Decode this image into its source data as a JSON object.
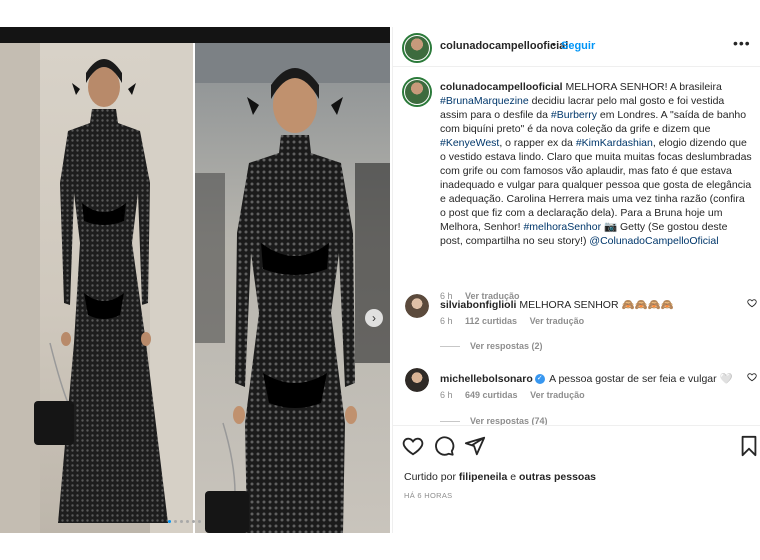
{
  "post": {
    "username": "colunadocampellooficial",
    "follow_label": "Seguir",
    "separator": "•",
    "more_label": "•••"
  },
  "caption": {
    "username": "colunadocampellooficial",
    "text_1": " MELHORA SENHOR! A brasileira ",
    "tag_1": "#BrunaMarquezine",
    "text_2": " decidiu lacrar pelo mal gosto e foi vestida assim para o desfile da ",
    "tag_2": "#Burberry",
    "text_3": " em Londres. A \"saída de banho com biquíni preto\" é da nova coleção da grife e dizem que ",
    "tag_3": "#KenyeWest",
    "text_4": ", o rapper ex da ",
    "tag_4": "#KimKardashian",
    "text_5": ", elogio dizendo que o vestido estava lindo. Claro que muita muitas focas deslumbradas com grife ou com famosos vão aplaudir, mas fato é que estava inadequado e vulgar para qualquer pessoa que gosta de elegância e adequação. Carolina Herrera mais uma vez tinha razão (confira o post que fiz com a declaração dela). Para a Bruna hoje um Melhora, Senhor! ",
    "tag_5": "#melhoraSenhor",
    "text_6": " 📷 Getty (Se gostou deste post, compartilha no seu story!) ",
    "tag_6": "@ColunadoCampelloOficial",
    "time": "6 h",
    "translate_label": "Ver tradução"
  },
  "comments": [
    {
      "username": "silviabonfiglioli",
      "text": "MELHORA SENHOR 🙈🙈🙈🙈",
      "time": "6 h",
      "likes": "112 curtidas",
      "translate_label": "Ver tradução",
      "replies_label": "Ver respostas (2)",
      "verified": false
    },
    {
      "username": "michellebolsonaro",
      "text": "A pessoa gostar de ser feia e vulgar 🤍",
      "time": "6 h",
      "likes": "649 curtidas",
      "translate_label": "Ver tradução",
      "replies_label": "Ver respostas (74)",
      "verified": true
    }
  ],
  "liked": {
    "prefix": "Curtido por ",
    "user": "filipeneila",
    "conjunction": " e ",
    "others": "outras pessoas"
  },
  "time_ago": "HÁ 6 HORAS",
  "colors": {
    "link": "#0095f6",
    "hashtag": "#00376b",
    "muted": "#8e8e8e",
    "verified": "#3897f0"
  },
  "icons": [
    "heart-icon",
    "comment-icon",
    "share-icon",
    "bookmark-icon",
    "more-icon",
    "chevron-right-icon"
  ]
}
